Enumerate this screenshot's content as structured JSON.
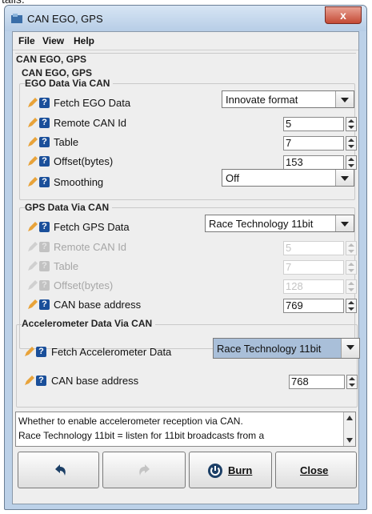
{
  "window": {
    "title": "CAN EGO, GPS"
  },
  "menu": [
    {
      "label": "File"
    },
    {
      "label": "View"
    },
    {
      "label": "Help"
    }
  ],
  "panels": {
    "outer_title": "CAN EGO, GPS",
    "inner_title": "CAN EGO, GPS"
  },
  "ego": {
    "title": "EGO Data Via CAN",
    "fetch": {
      "label": "Fetch EGO Data",
      "value": "Innovate format"
    },
    "remote_can_id": {
      "label": "Remote CAN Id",
      "value": "5"
    },
    "table": {
      "label": "Table",
      "value": "7"
    },
    "offset": {
      "label": "Offset(bytes)",
      "value": "153"
    },
    "smoothing": {
      "label": "Smoothing",
      "value": "Off"
    }
  },
  "gps": {
    "title": "GPS Data Via CAN",
    "fetch": {
      "label": "Fetch GPS Data",
      "value": "Race Technology 11bit"
    },
    "remote_can_id": {
      "label": "Remote CAN Id",
      "value": "5"
    },
    "table": {
      "label": "Table",
      "value": "7"
    },
    "offset": {
      "label": "Offset(bytes)",
      "value": "128"
    },
    "base_address": {
      "label": "CAN base address",
      "value": "769"
    }
  },
  "accel": {
    "title": "Accelerometer Data Via CAN",
    "fetch": {
      "label": "Fetch Accelerometer Data",
      "value": "Race Technology 11bit"
    },
    "base_address": {
      "label": "CAN base address",
      "value": "768"
    }
  },
  "description": {
    "line1": "Whether to enable accelerometer reception via CAN.",
    "line2": "Race Technology 11bit = listen for 11bit broadcasts from a"
  },
  "buttons": {
    "burn": "Burn",
    "close": "Close"
  },
  "colors": {
    "help_icon": "#1a4f9a",
    "pencil": "#e8a33a",
    "highlight_combo": "#a9bfd9",
    "burn_icon": "#1c3f66"
  }
}
